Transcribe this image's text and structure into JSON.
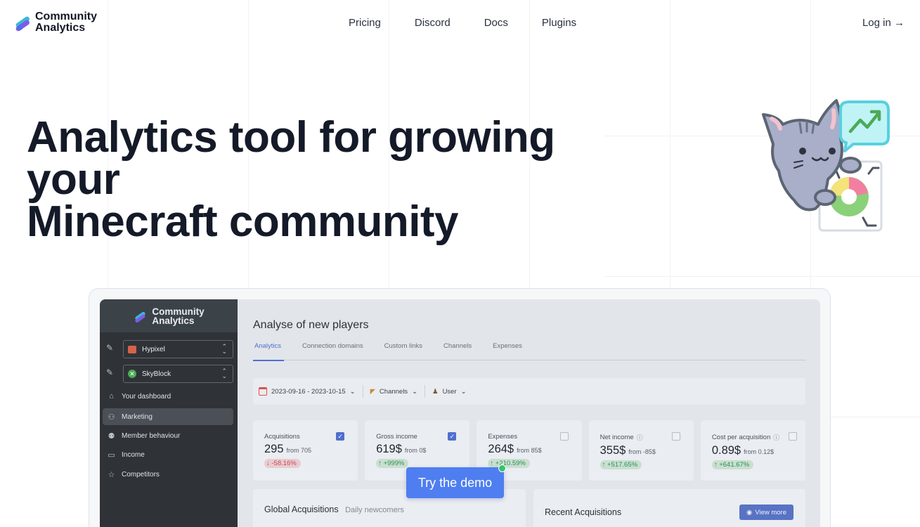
{
  "nav": {
    "logo_line1": "Community",
    "logo_line2": "Analytics",
    "links": [
      "Pricing",
      "Discord",
      "Docs",
      "Plugins"
    ],
    "login": "Log in →"
  },
  "hero": {
    "title_line1": "Analytics tool for growing your",
    "title_line2": "Minecraft community"
  },
  "dashboard": {
    "logo_line1": "Community",
    "logo_line2": "Analytics",
    "server_select": "Hypixel",
    "gamemode_select": "SkyBlock",
    "sidebar": [
      {
        "label": "Your dashboard",
        "icon": "home-icon"
      },
      {
        "label": "Marketing",
        "icon": "user-plus-icon"
      },
      {
        "label": "Member behaviour",
        "icon": "users-icon"
      },
      {
        "label": "Income",
        "icon": "money-icon"
      },
      {
        "label": "Competitors",
        "icon": "star-icon"
      }
    ],
    "title": "Analyse of new players",
    "tabs": [
      "Analytics",
      "Connection domains",
      "Custom links",
      "Channels",
      "Expenses"
    ],
    "filters": {
      "date_range": "2023-09-16 - 2023-10-15",
      "channels": "Channels",
      "user": "User"
    },
    "cards": [
      {
        "label": "Acquisitions",
        "value": "295",
        "from": "from 705",
        "change": "-58.16%",
        "trend": "down",
        "checked": true,
        "info": false
      },
      {
        "label": "Gross income",
        "value": "619$",
        "from": "from 0$",
        "change": "+999%",
        "trend": "up",
        "checked": true,
        "info": false
      },
      {
        "label": "Expenses",
        "value": "264$",
        "from": "from 85$",
        "change": "+210.59%",
        "trend": "up",
        "checked": false,
        "info": false
      },
      {
        "label": "Net income",
        "value": "355$",
        "from": "from -85$",
        "change": "+517.65%",
        "trend": "up",
        "checked": false,
        "info": true
      },
      {
        "label": "Cost per acquisition",
        "value": "0.89$",
        "from": "from 0.12$",
        "change": "+641.67%",
        "trend": "up",
        "checked": false,
        "info": true
      }
    ],
    "global_acquisitions": "Global Acquisitions",
    "global_acquisitions_sub": "Daily newcomers",
    "recent_acquisitions": "Recent Acquisitions",
    "view_more": "View more"
  },
  "demo_button": "Try the demo",
  "colors": {
    "accent": "#4f7ef0",
    "dashboard_accent": "#4f6fd0",
    "sidebar_bg": "#2f3337",
    "positive": "#2f8f55",
    "negative": "#cc4a55",
    "demo_dot": "#35c36b"
  }
}
